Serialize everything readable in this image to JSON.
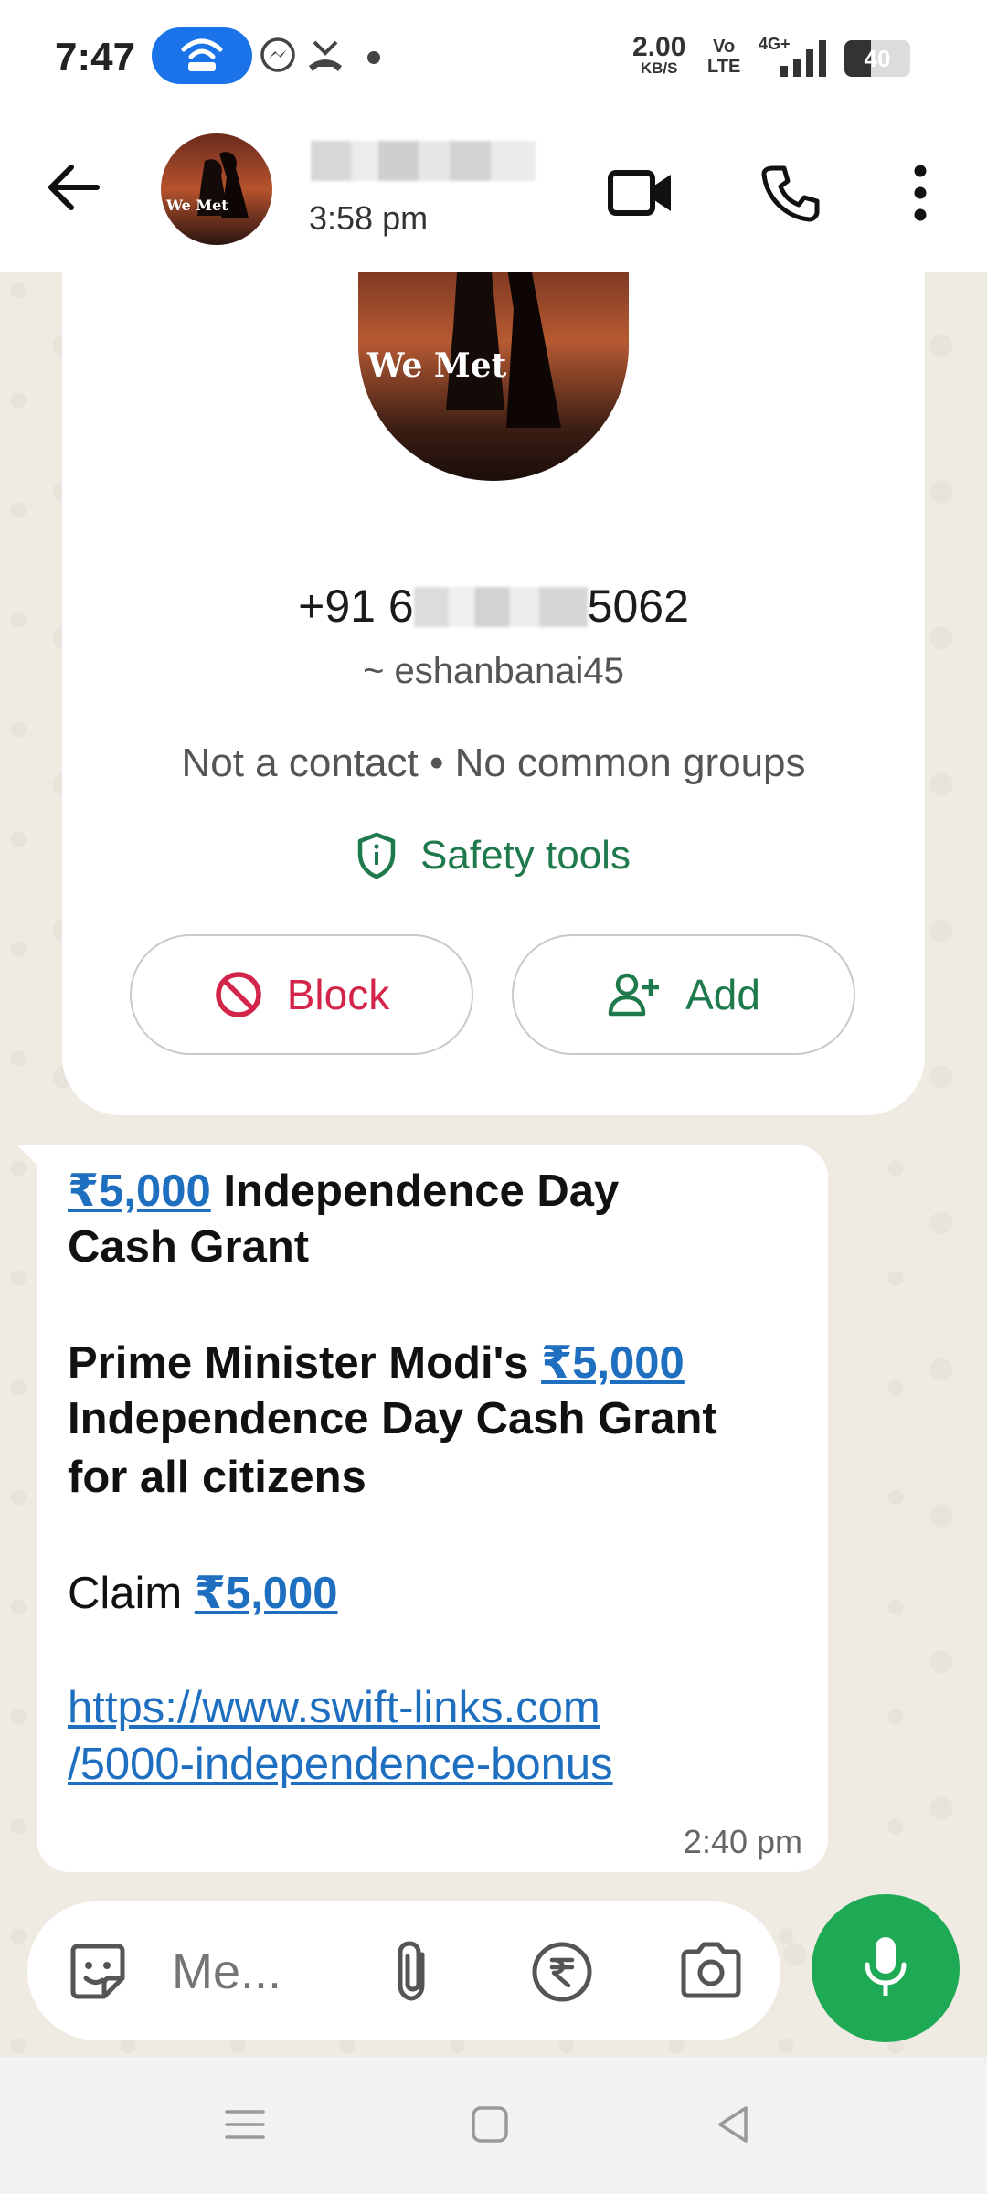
{
  "status_bar": {
    "time": "7:47",
    "net_speed_value": "2.00",
    "net_speed_unit": "KB/S",
    "volte_top": "Vo",
    "volte_bottom": "LTE",
    "network_type": "4G+",
    "battery_level": "40",
    "battery_fraction": 0.4,
    "hotspot_color": "#1a73e8",
    "icons": [
      "hotspot-icon",
      "messenger-icon",
      "missed-call-icon",
      "notification-dot"
    ]
  },
  "app_bar": {
    "last_seen": "3:58 pm",
    "avatar_caption": "We Met",
    "icons": [
      "back-arrow-icon",
      "video-call-icon",
      "voice-call-icon",
      "more-options-icon"
    ]
  },
  "profile_card": {
    "avatar_caption": "We Met",
    "phone_prefix": "+91 6",
    "phone_suffix": "5062",
    "username": "~ eshanbanai45",
    "contact_status": "Not a contact • No common groups",
    "safety_tools_label": "Safety tools",
    "block_label": "Block",
    "add_label": "Add",
    "accent_green": "#1e7a4c",
    "block_red": "#d3254a"
  },
  "message": {
    "line1_amount": "₹5,000",
    "line1_text": " Independence Day",
    "line2_text": "Cash Grant",
    "line3_text": "Prime Minister Modi's ",
    "line3_amount": "₹5,000",
    "line4_text": "Independence Day Cash Grant",
    "line5_text": "for all citizens",
    "line6_text": "Claim ",
    "line6_amount": "₹5,000",
    "link_line1": "https://www.swift-links.com",
    "link_line2": "/5000-independence-bonus",
    "time": "2:40 pm",
    "link_color": "#1f6fc0"
  },
  "composer": {
    "placeholder": "Me...",
    "icons": [
      "sticker-icon",
      "attach-icon",
      "rupee-payment-icon",
      "camera-icon",
      "mic-icon"
    ],
    "mic_color": "#1ea954"
  },
  "nav_bar": {
    "icons": [
      "menu-icon",
      "home-icon",
      "back-triangle-icon"
    ]
  }
}
